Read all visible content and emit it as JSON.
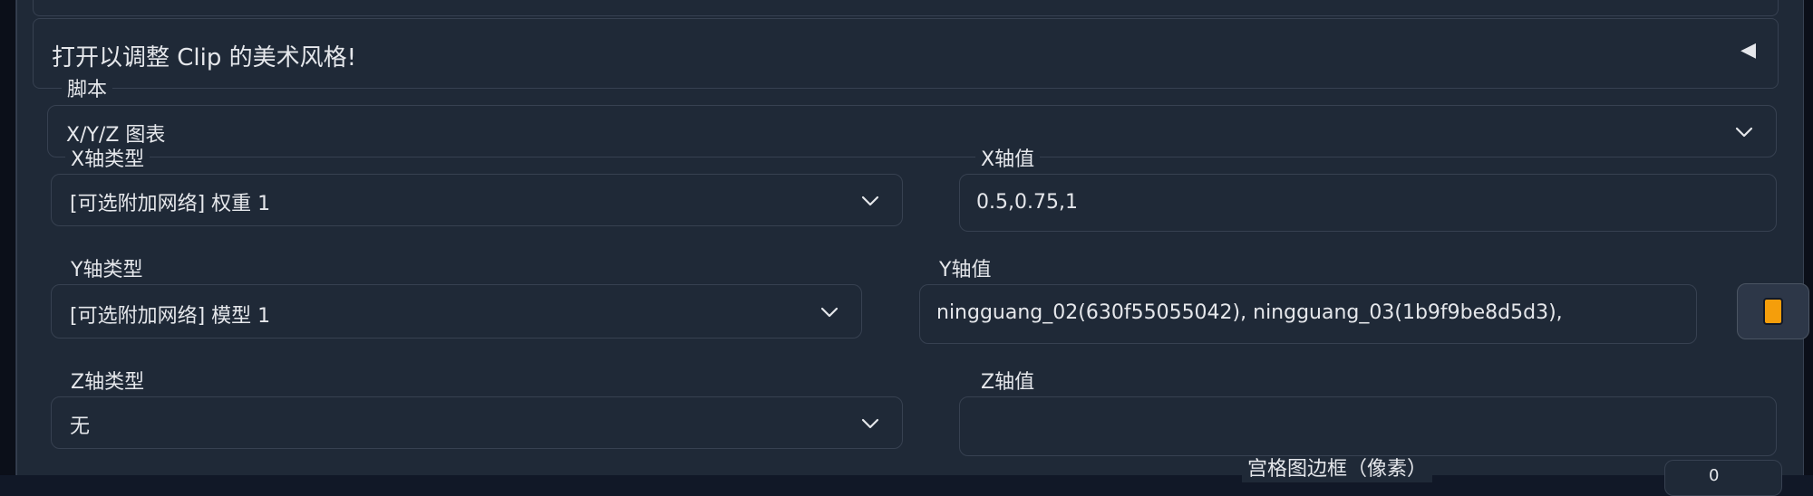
{
  "accordion": {
    "title": "打开以调整 Clip 的美术风格!",
    "arrow": "◀"
  },
  "script": {
    "label": "脚本",
    "value": "X/Y/Z 图表"
  },
  "x_type": {
    "label": "X轴类型",
    "value": "[可选附加网络] 权重 1"
  },
  "x_values": {
    "label": "X轴值",
    "value": "0.5,0.75,1"
  },
  "y_type": {
    "label": "Y轴类型",
    "value": "[可选附加网络] 模型 1"
  },
  "y_values": {
    "label": "Y轴值",
    "value": "ningguang_02(630f55055042), ningguang_03(1b9f9be8d5d3),"
  },
  "z_type": {
    "label": "Z轴类型",
    "value": "无"
  },
  "z_values": {
    "label": "Z轴值",
    "value": ""
  },
  "grid_margin": {
    "label": "宫格图边框（像素）",
    "value": "0"
  },
  "icons": {
    "chevron": "chevron-down-icon",
    "fill": "fill-values-icon",
    "collapse": "triangle-left-icon"
  },
  "colors": {
    "accent": "#f59e0b",
    "panel": "#1f2937",
    "border": "#374151",
    "background": "#111827"
  }
}
